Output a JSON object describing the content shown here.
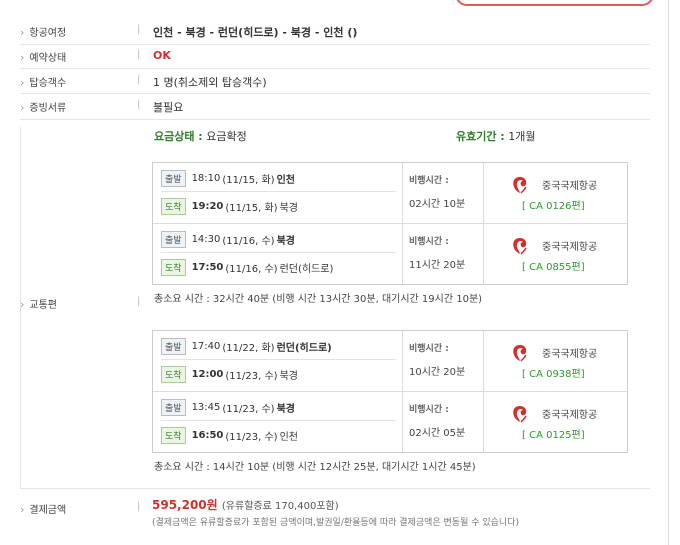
{
  "rows": {
    "route": {
      "label": "항공여정",
      "value": "인천 - 북경 - 런던(히드로) - 북경 - 인천 ()"
    },
    "status": {
      "label": "예약상태",
      "value": "OK"
    },
    "passengers": {
      "label": "탑승객수",
      "value": "1 명(취소제외 탑승객수)"
    },
    "documents": {
      "label": "증빙서류",
      "value": "불필요"
    },
    "transport": {
      "label": "교통편"
    },
    "payment": {
      "label": "결제금액"
    }
  },
  "fare": {
    "status_label": "요금상태 :",
    "status_value": "요금확정",
    "valid_label": "유효기간 :",
    "valid_value": "1개월"
  },
  "tags": {
    "depart": "출발",
    "arrive": "도착"
  },
  "flight_time_label": "비행시간 :",
  "groups": [
    {
      "segments": [
        {
          "dep_time": "18:10",
          "dep_date": "(11/15, 화)",
          "dep_city": "인천",
          "arr_time": "19:20",
          "arr_date": "(11/15, 화)",
          "arr_city": "북경",
          "duration": "02시간 10분",
          "airline": "중국국제항공",
          "flight": "[ CA 0126편]"
        },
        {
          "dep_time": "14:30",
          "dep_date": "(11/16, 수)",
          "dep_city": "북경",
          "arr_time": "17:50",
          "arr_date": "(11/16, 수)",
          "arr_city": "런던(히드로)",
          "duration": "11시간 20분",
          "airline": "중국국제항공",
          "flight": "[ CA 0855편]"
        }
      ],
      "total": "총소요 시간 : 32시간 40분 (비행 시간 13시간 30분, 대기시간 19시간 10분)"
    },
    {
      "segments": [
        {
          "dep_time": "17:40",
          "dep_date": "(11/22, 화)",
          "dep_city": "런던(히드로)",
          "arr_time": "12:00",
          "arr_date": "(11/23, 수)",
          "arr_city": "북경",
          "duration": "10시간 20분",
          "airline": "중국국제항공",
          "flight": "[ CA 0938편]"
        },
        {
          "dep_time": "13:45",
          "dep_date": "(11/23, 수)",
          "dep_city": "북경",
          "arr_time": "16:50",
          "arr_date": "(11/23, 수)",
          "arr_city": "인천",
          "duration": "02시간 05분",
          "airline": "중국국제항공",
          "flight": "[ CA 0125편]"
        }
      ],
      "total": "총소요 시간 : 14시간 10분 (비행 시간 12시간 25분, 대기시간 1시간 45분)"
    }
  ],
  "payment": {
    "amount": "595,200원",
    "detail": "(유류할증료 170,400포함)",
    "note": "(결제금액은 유류할증료가 포함된 금액이며,발권일/환율등에 따라 결제금액은 변동될 수 있습니다)"
  },
  "colors": {
    "accent_red": "#d0312d",
    "accent_green": "#2f7d2b"
  }
}
